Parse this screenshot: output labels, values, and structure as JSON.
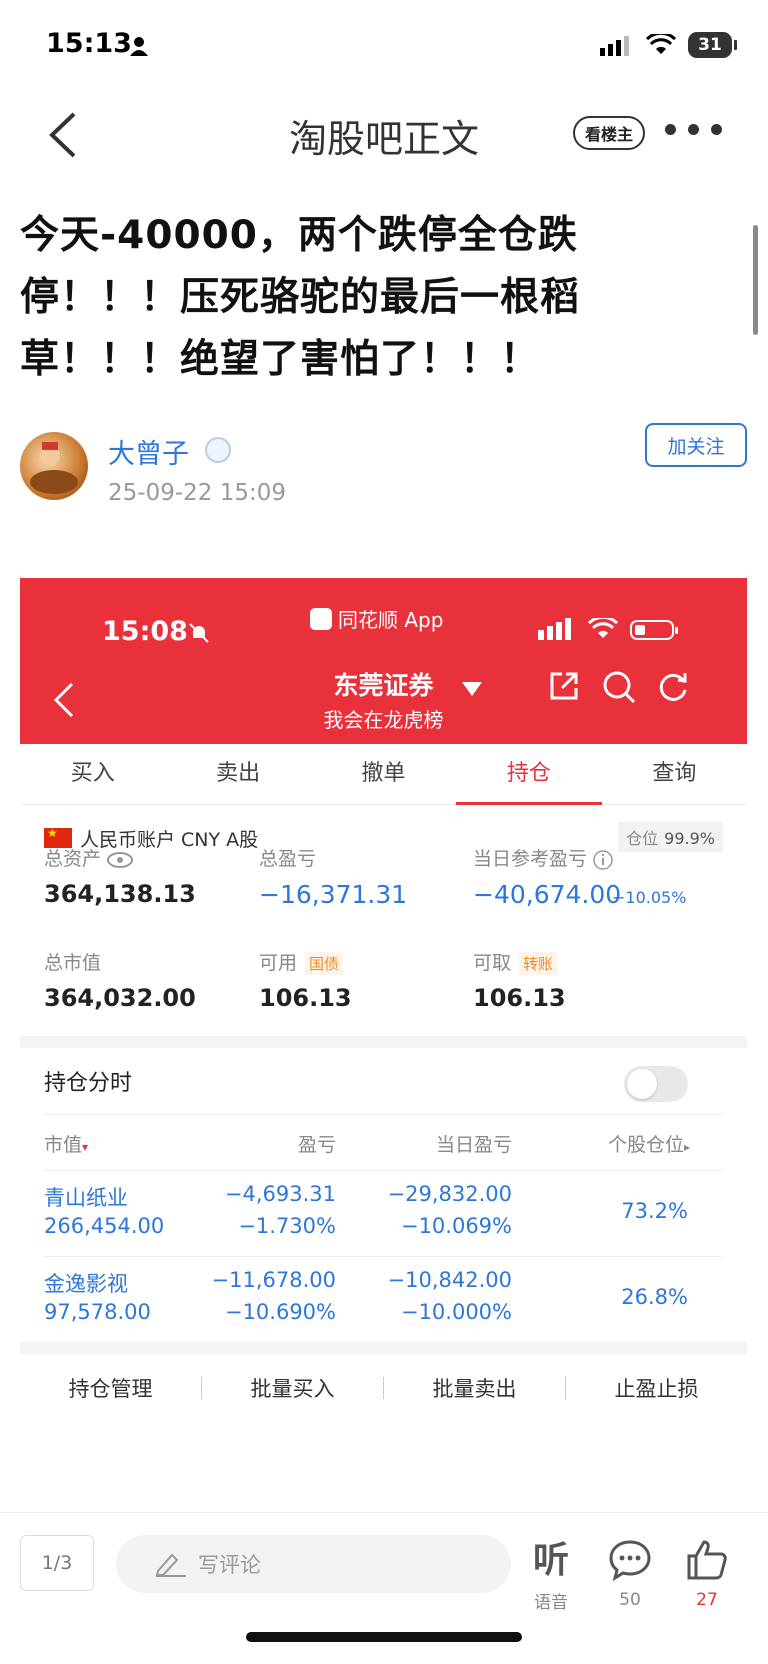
{
  "status_bar": {
    "time": "15:13",
    "battery": "31"
  },
  "header": {
    "title": "淘股吧正文",
    "louzhu_label": "看楼主"
  },
  "post": {
    "title": "今天-40000，两个跌停全仓跌停！！！压死骆驼的最后一根稻草！！！绝望了害怕了！！！",
    "author": "大曾子",
    "time": "25-09-22 15:09",
    "follow_label": "加关注"
  },
  "screenshot": {
    "status_time": "15:08",
    "app_name": "同花顺 App",
    "broker": "东莞证券",
    "broker_sub": "我会在龙虎榜",
    "tabs": [
      "买入",
      "卖出",
      "撤单",
      "持仓",
      "查询"
    ],
    "active_tab": "持仓",
    "account": "人民币账户 CNY A股",
    "position_label": "仓位",
    "position_value": "99.9%",
    "total_assets_label": "总资产",
    "total_assets": "364,138.13",
    "total_pl_label": "总盈亏",
    "total_pl": "−16,371.31",
    "day_pl_label": "当日参考盈亏",
    "day_pl": "−40,674.00",
    "day_pl_pct": "−10.05%",
    "market_value_label": "总市值",
    "market_value": "364,032.00",
    "available_label": "可用",
    "available_tag": "国债",
    "available": "106.13",
    "withdrawable_label": "可取",
    "withdrawable_tag": "转账",
    "withdrawable": "106.13",
    "hold_time_label": "持仓分时",
    "columns": [
      "市值",
      "盈亏",
      "当日盈亏",
      "个股仓位"
    ],
    "holdings": [
      {
        "name": "青山纸业",
        "market_value": "266,454.00",
        "pl": "−4,693.31",
        "pl_pct": "−1.730%",
        "day_pl": "−29,832.00",
        "day_pct": "−10.069%",
        "weight": "73.2%"
      },
      {
        "name": "金逸影视",
        "market_value": "97,578.00",
        "pl": "−11,678.00",
        "pl_pct": "−10.690%",
        "day_pl": "−10,842.00",
        "day_pct": "−10.000%",
        "weight": "26.8%"
      }
    ],
    "bottom_actions": [
      "持仓管理",
      "批量买入",
      "批量卖出",
      "止盈止损"
    ]
  },
  "bottom_bar": {
    "page_indicator": "1/3",
    "comment_placeholder": "写评论",
    "listen_glyph": "听",
    "listen_label": "语音",
    "comment_count": "50",
    "like_count": "27"
  },
  "colors": {
    "accent_red": "#e8313a",
    "link_blue": "#2c77d8"
  }
}
